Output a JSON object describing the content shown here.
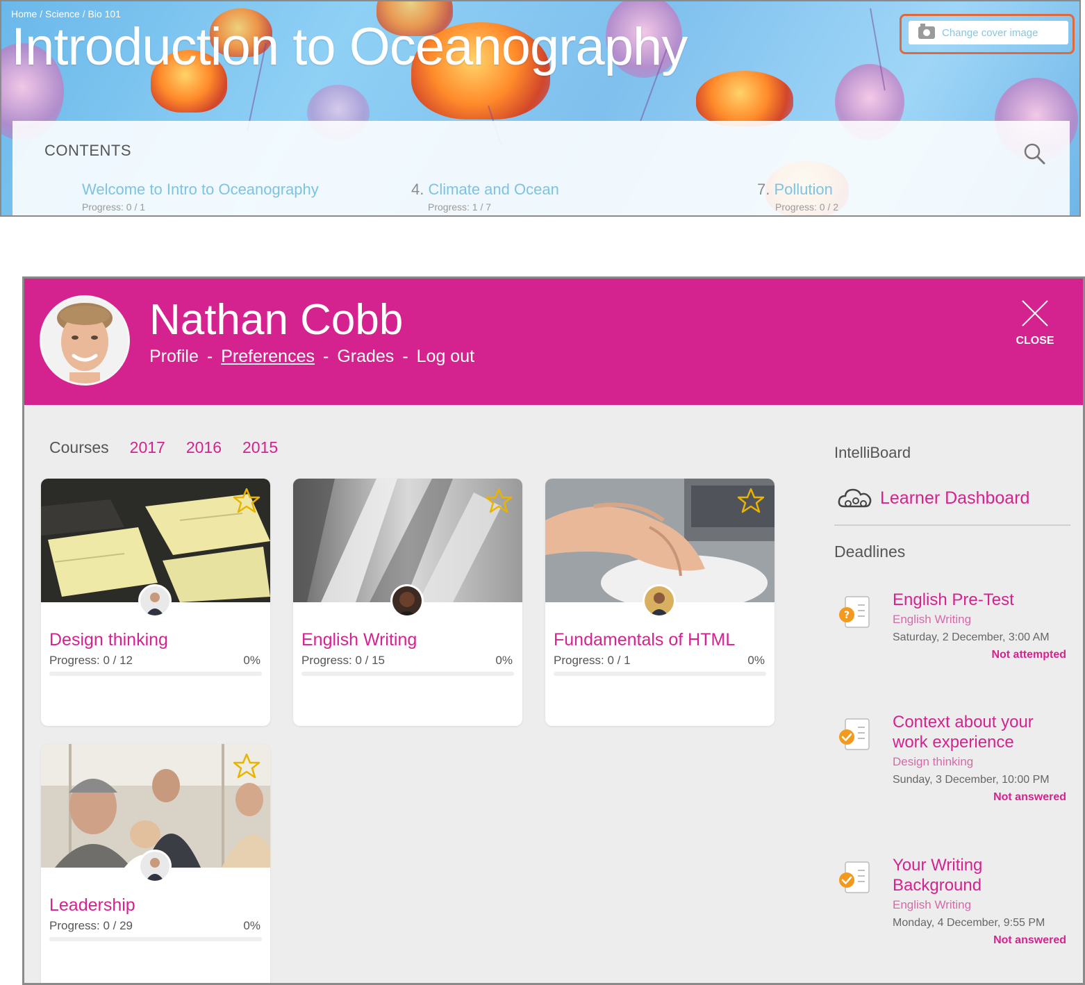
{
  "course_banner": {
    "breadcrumb": "Home /  Science /  Bio 101",
    "title": "Introduction to Oceanography",
    "change_cover_label": "Change cover image",
    "contents_heading": "CONTENTS",
    "contents_items": [
      {
        "number": "",
        "title": "Welcome to Intro to Oceanography",
        "progress": "Progress: 0 / 1"
      },
      {
        "number": "4.",
        "title": "Climate and Ocean",
        "progress": "Progress: 1 / 7"
      },
      {
        "number": "7.",
        "title": "Pollution",
        "progress": "Progress: 0 / 2"
      }
    ]
  },
  "profile_drawer": {
    "user_name": "Nathan Cobb",
    "nav": {
      "profile": "Profile",
      "preferences": "Preferences",
      "grades": "Grades",
      "logout": "Log out",
      "separator": "-"
    },
    "close_label": "CLOSE",
    "filters": {
      "courses": "Courses",
      "years": [
        "2017",
        "2016",
        "2015"
      ]
    },
    "courses": [
      {
        "title": "Design thinking",
        "progress": "Progress: 0 / 12",
        "percent": "0%",
        "progress_fraction": 0
      },
      {
        "title": "English Writing",
        "progress": "Progress: 0 / 15",
        "percent": "0%",
        "progress_fraction": 0
      },
      {
        "title": "Fundamentals of HTML",
        "progress": "Progress: 0 / 1",
        "percent": "0%",
        "progress_fraction": 0
      },
      {
        "title": "Leadership",
        "progress": "Progress: 0 / 29",
        "percent": "0%",
        "progress_fraction": 0
      }
    ],
    "sidebar": {
      "intelliboard_heading": "IntelliBoard",
      "learner_dashboard": "Learner Dashboard",
      "deadlines_heading": "Deadlines",
      "deadlines": [
        {
          "title": "English Pre-Test",
          "course": "English Writing",
          "date": "Saturday, 2 December, 3:00 AM",
          "status": "Not attempted",
          "icon": "question-badge-icon"
        },
        {
          "title": "Context about your work experience",
          "course": "Design thinking",
          "date": "Sunday, 3 December, 10:00 PM",
          "status": "Not answered",
          "icon": "check-badge-icon"
        },
        {
          "title": "Your Writing Background",
          "course": "English Writing",
          "date": "Monday, 4 December, 9:55 PM",
          "status": "Not answered",
          "icon": "check-badge-icon"
        }
      ]
    }
  },
  "colors": {
    "brand_magenta": "#d4238f",
    "banner_link_blue": "#7cc3e3",
    "highlight_orange": "#e0683a",
    "badge_orange": "#f39a1e",
    "star_gold": "#e8b400"
  }
}
